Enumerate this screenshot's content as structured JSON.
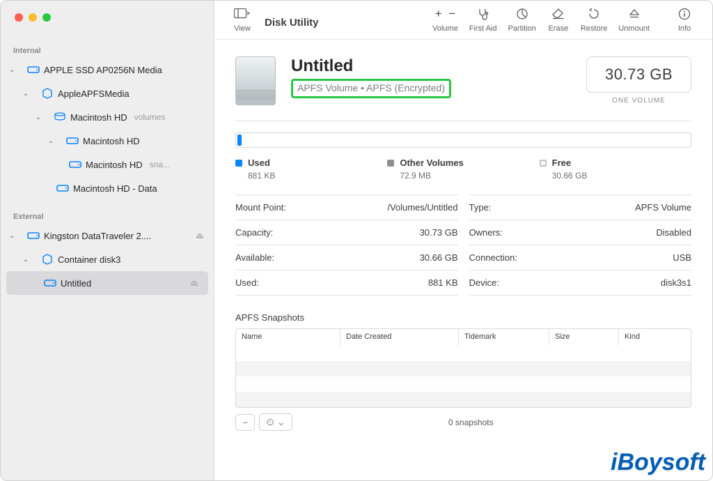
{
  "window": {
    "app_title": "Disk Utility"
  },
  "toolbar": {
    "view": "View",
    "volume": "Volume",
    "first_aid": "First Aid",
    "partition": "Partition",
    "erase": "Erase",
    "restore": "Restore",
    "unmount": "Unmount",
    "info": "Info"
  },
  "sidebar": {
    "internal_label": "Internal",
    "external_label": "External",
    "internal": {
      "root": "APPLE SSD AP0256N Media",
      "container": "AppleAPFSMedia",
      "group": {
        "name": "Macintosh HD",
        "suffix": "volumes"
      },
      "vol_a": "Macintosh HD",
      "vol_a_snap": {
        "name": "Macintosh HD",
        "suffix": "sna..."
      },
      "vol_b": "Macintosh HD - Data"
    },
    "external": {
      "root": "Kingston DataTraveler 2....",
      "container": "Container disk3",
      "vol": "Untitled"
    }
  },
  "volume": {
    "name": "Untitled",
    "subtitle": "APFS Volume • APFS (Encrypted)",
    "capacity": "30.73 GB",
    "capacity_label": "ONE VOLUME"
  },
  "legend": {
    "used_label": "Used",
    "used_value": "881 KB",
    "other_label": "Other Volumes",
    "other_value": "72.9 MB",
    "free_label": "Free",
    "free_value": "30.66 GB"
  },
  "info_left": {
    "mount_k": "Mount Point:",
    "mount_v": "/Volumes/Untitled",
    "cap_k": "Capacity:",
    "cap_v": "30.73 GB",
    "avail_k": "Available:",
    "avail_v": "30.66 GB",
    "used_k": "Used:",
    "used_v": "881 KB"
  },
  "info_right": {
    "type_k": "Type:",
    "type_v": "APFS Volume",
    "own_k": "Owners:",
    "own_v": "Disabled",
    "conn_k": "Connection:",
    "conn_v": "USB",
    "dev_k": "Device:",
    "dev_v": "disk3s1"
  },
  "snapshots": {
    "title": "APFS Snapshots",
    "cols": {
      "name": "Name",
      "date": "Date Created",
      "tide": "Tidemark",
      "size": "Size",
      "kind": "Kind"
    },
    "footer": "0 snapshots"
  },
  "watermark": "iBoysoft"
}
